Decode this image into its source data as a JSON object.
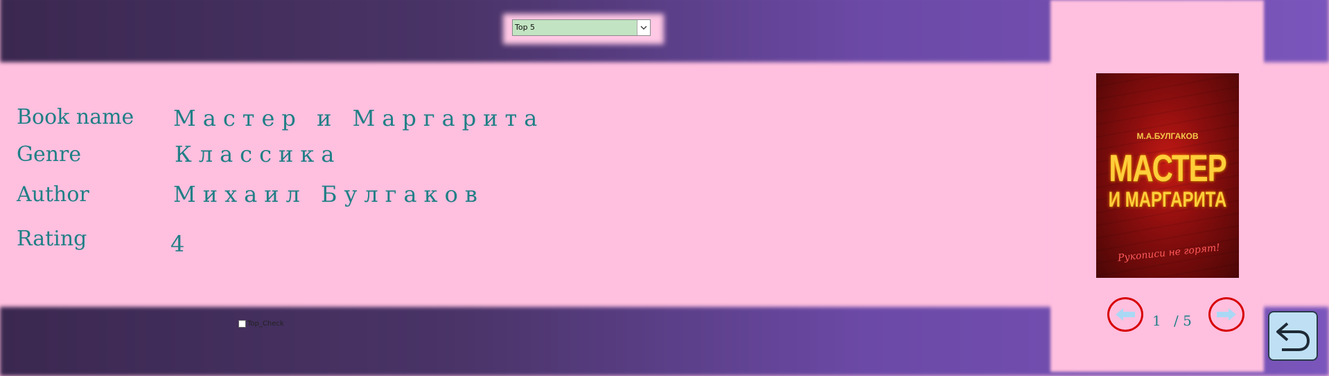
{
  "colors": {
    "background": "#ffbfdf",
    "band_start": "#3b2850",
    "band_end": "#7a55bb",
    "text_teal": "#1f7f86",
    "dropdown_bg": "#c2e4c2",
    "nav_ring": "#d80000",
    "nav_arrow": "#a9d8f4",
    "back_button_bg": "#bfe0f4"
  },
  "filter": {
    "selected": "Top 5"
  },
  "fields": {
    "book_name_label": "Book name",
    "book_name_value": "Мастер и Маргарита",
    "genre_label": "Genre",
    "genre_value": "Классика",
    "author_label": "Author",
    "author_value": "Михаил Булгаков",
    "rating_label": "Rating",
    "rating_value": "4"
  },
  "cover": {
    "author": "М.А.БУЛГАКОВ",
    "title_line1": "МАСТЕР",
    "title_line2": "И МАРГАРИТА",
    "tagline": "Рукописи не горят!"
  },
  "pager": {
    "current": "1",
    "total": "/ 5"
  },
  "top_check": {
    "label": "Top_Check",
    "checked": false
  },
  "icons": {
    "prev": "arrow-left-icon",
    "next": "arrow-right-icon",
    "back": "return-arrow-icon",
    "dropdown": "chevron-down-icon"
  }
}
